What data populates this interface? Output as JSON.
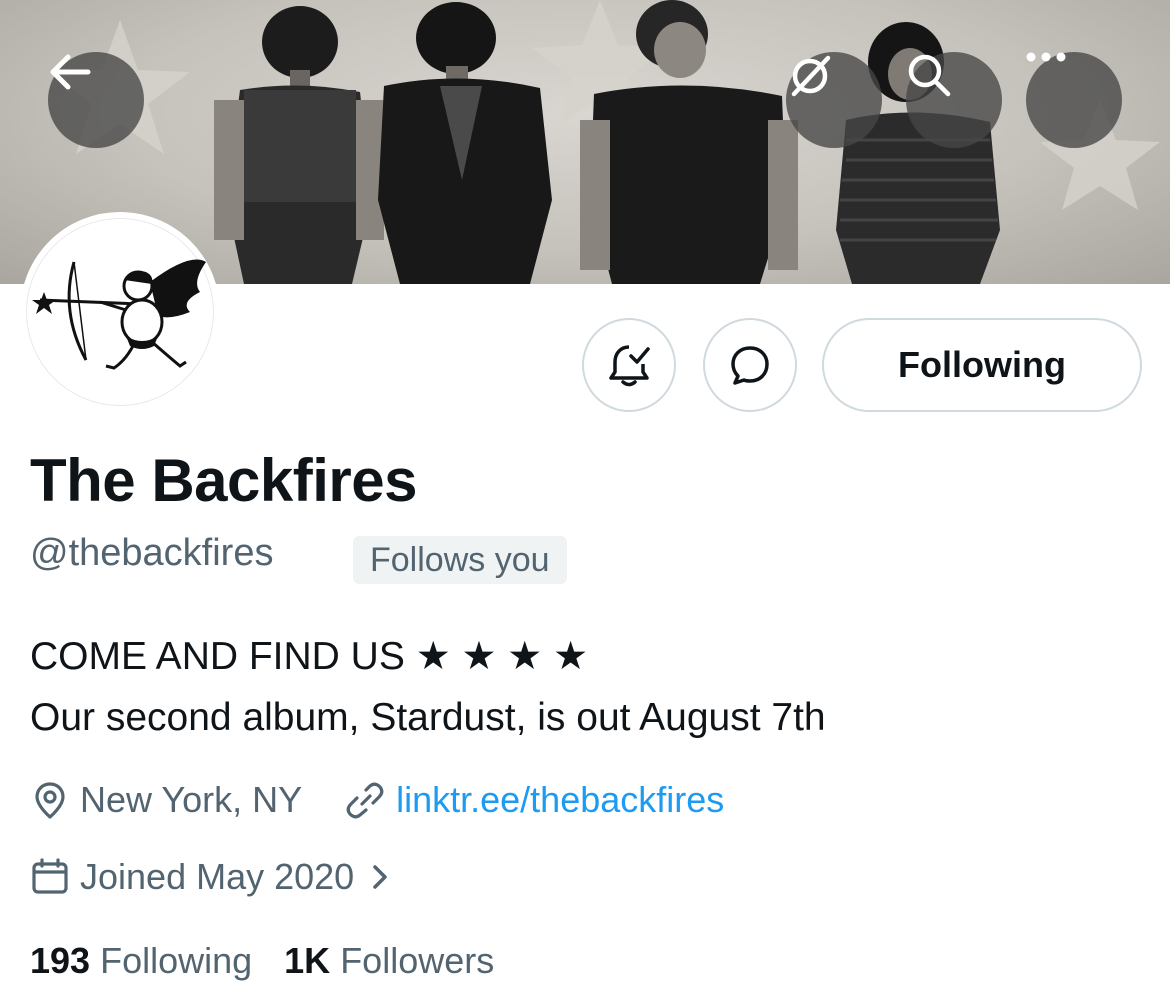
{
  "header": {
    "back_icon": "arrow-left-icon",
    "translate_icon": "translate-disabled-icon",
    "search_icon": "search-icon",
    "more_icon": "more-horizontal-icon",
    "button_bg": "#464646"
  },
  "actions": {
    "notify_icon": "bell-check-icon",
    "message_icon": "message-bubble-icon",
    "following_label": "Following"
  },
  "profile": {
    "display_name": "The Backfires",
    "handle": "@thebackfires",
    "follows_you": "Follows you",
    "bio_line1": "COME AND FIND US ★ ★ ★ ★",
    "bio_line2": "Our second album, Stardust, is out August 7th",
    "location": "New York, NY",
    "link": "linktr.ee/thebackfires",
    "joined": "Joined May 2020"
  },
  "stats": {
    "following_count": "193",
    "following_label": "Following",
    "followers_count": "1K",
    "followers_label": "Followers"
  },
  "colors": {
    "text_primary": "#0f1419",
    "text_secondary": "#536471",
    "link": "#1d9bf0",
    "border": "#cfd9de",
    "badge_bg": "#eff3f4"
  }
}
